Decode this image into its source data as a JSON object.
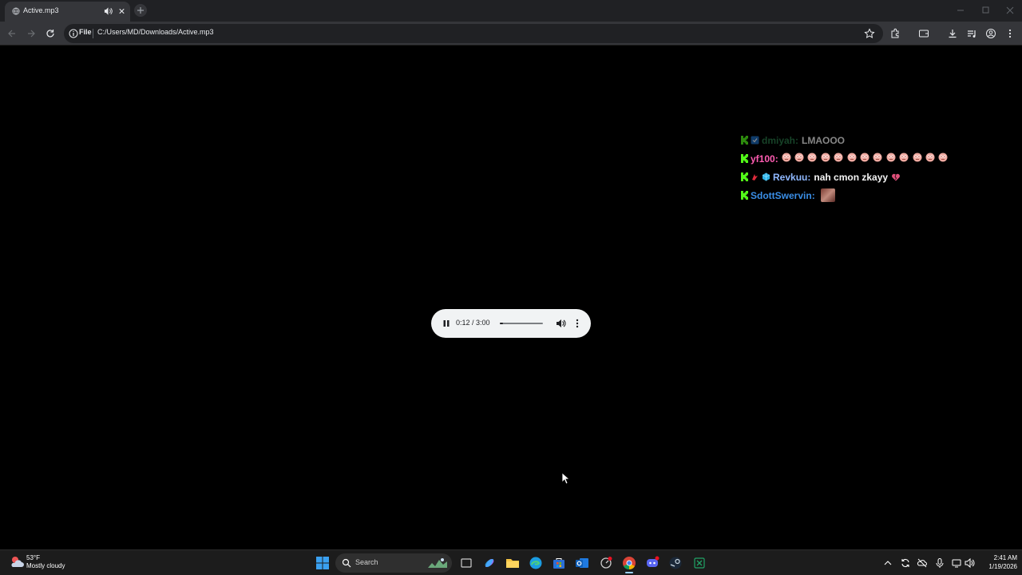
{
  "tab": {
    "title": "Active.mp3"
  },
  "omnibox": {
    "scheme_label": "File",
    "url": "C:/Users/MD/Downloads/Active.mp3"
  },
  "chat": {
    "messages": [
      {
        "user": "dmiyah",
        "text": "LMAOOO",
        "user_color": "#2a7a4a",
        "faded": true
      },
      {
        "user": "yf100",
        "text": "",
        "user_color": "#ff5cb2",
        "emote_count": 13
      },
      {
        "user": "Revkuu",
        "text": "nah cmon zkayy",
        "user_color": "#8fb8ff"
      },
      {
        "user": "SdottSwervin",
        "text": "",
        "user_color": "#3a8ee6"
      }
    ],
    "separator": ":"
  },
  "player": {
    "time": "0:12 / 3:00",
    "progress": 0.067
  },
  "taskbar": {
    "weather_temp": "53°F",
    "weather_desc": "Mostly cloudy",
    "search_label": "Search",
    "clock_time": "2:41 AM",
    "clock_date": "1/19/2026"
  },
  "colors": {
    "accent_kick": "#53fc18",
    "page_bg": "#000000",
    "chrome_bg": "#35363a"
  }
}
